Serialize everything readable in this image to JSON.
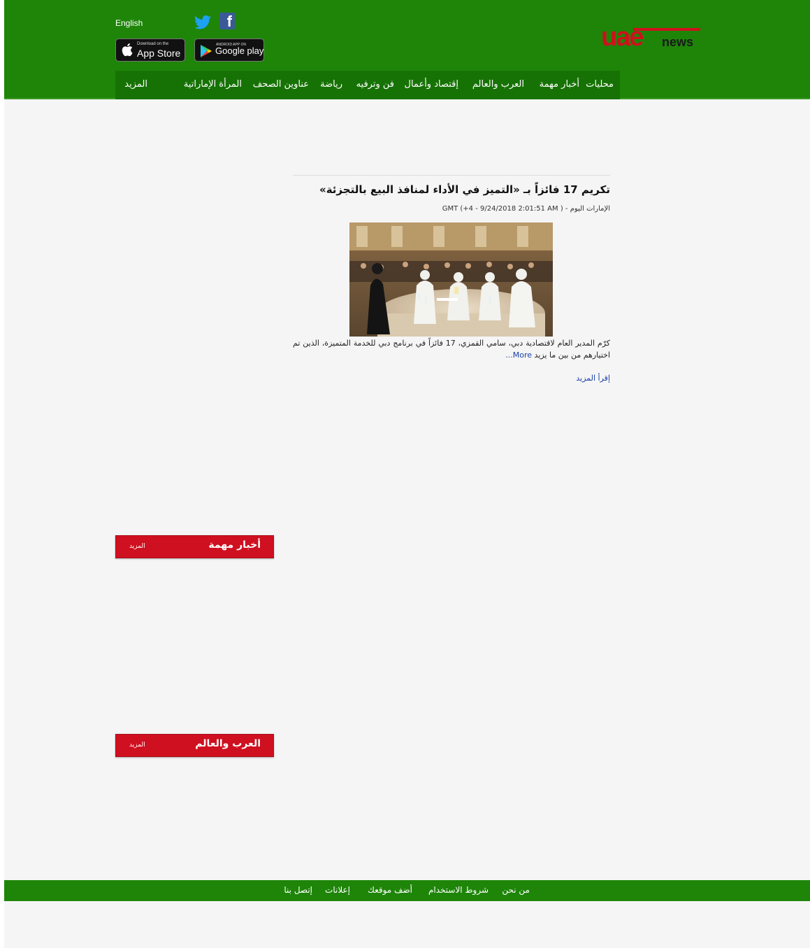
{
  "header": {
    "language_link": "English",
    "app_store": {
      "small_text": "Download on the",
      "big_text": "App Store"
    },
    "google_play": {
      "small_text": "ANDROID APP ON",
      "big_text": "Google play"
    },
    "logo": {
      "main": "uae",
      "suffix": "news"
    }
  },
  "nav": {
    "items": [
      "محليات",
      "أخبار مهمة",
      "العرب والعالم",
      "إقتصاد وأعمال",
      "فن وترفيه",
      "رياضة",
      "عناوين الصحف",
      "المرأة الإماراتية",
      "المزيد"
    ]
  },
  "article": {
    "headline": "تكريم 17 فائزاً بـ «التميز في الأداء لمنافذ البيع بالتجزئة»",
    "meta": "الإمارات اليوم - ( GMT (+4 - 9/24/2018 2:01:51 AM",
    "summary": "كرّم المدير العام لاقتصادية دبي، سامي القمزي، 17 فائزاً في برنامج دبي للخدمة المتميزة، الذين تم اختيارهم من بين ما يزيد",
    "more_inline": "More...",
    "read_more": "إقرأ المزيد"
  },
  "sections": [
    {
      "title": "أخبار مهمة",
      "more": "المزيد"
    },
    {
      "title": "العرب والعالم",
      "more": "المزيد"
    }
  ],
  "footer": {
    "items": [
      "من نحن",
      "شروط الاستخدام",
      "أضف موقعك",
      "إعلانات",
      "إتصل بنا"
    ]
  },
  "colors": {
    "header_green": "#1e8509",
    "nav_green": "#177205",
    "section_red": "#cf1020",
    "link_blue": "#1a3fa8",
    "logo_red": "#d0101d"
  },
  "icons": [
    "twitter-icon",
    "facebook-icon",
    "apple-icon",
    "google-play-icon"
  ]
}
